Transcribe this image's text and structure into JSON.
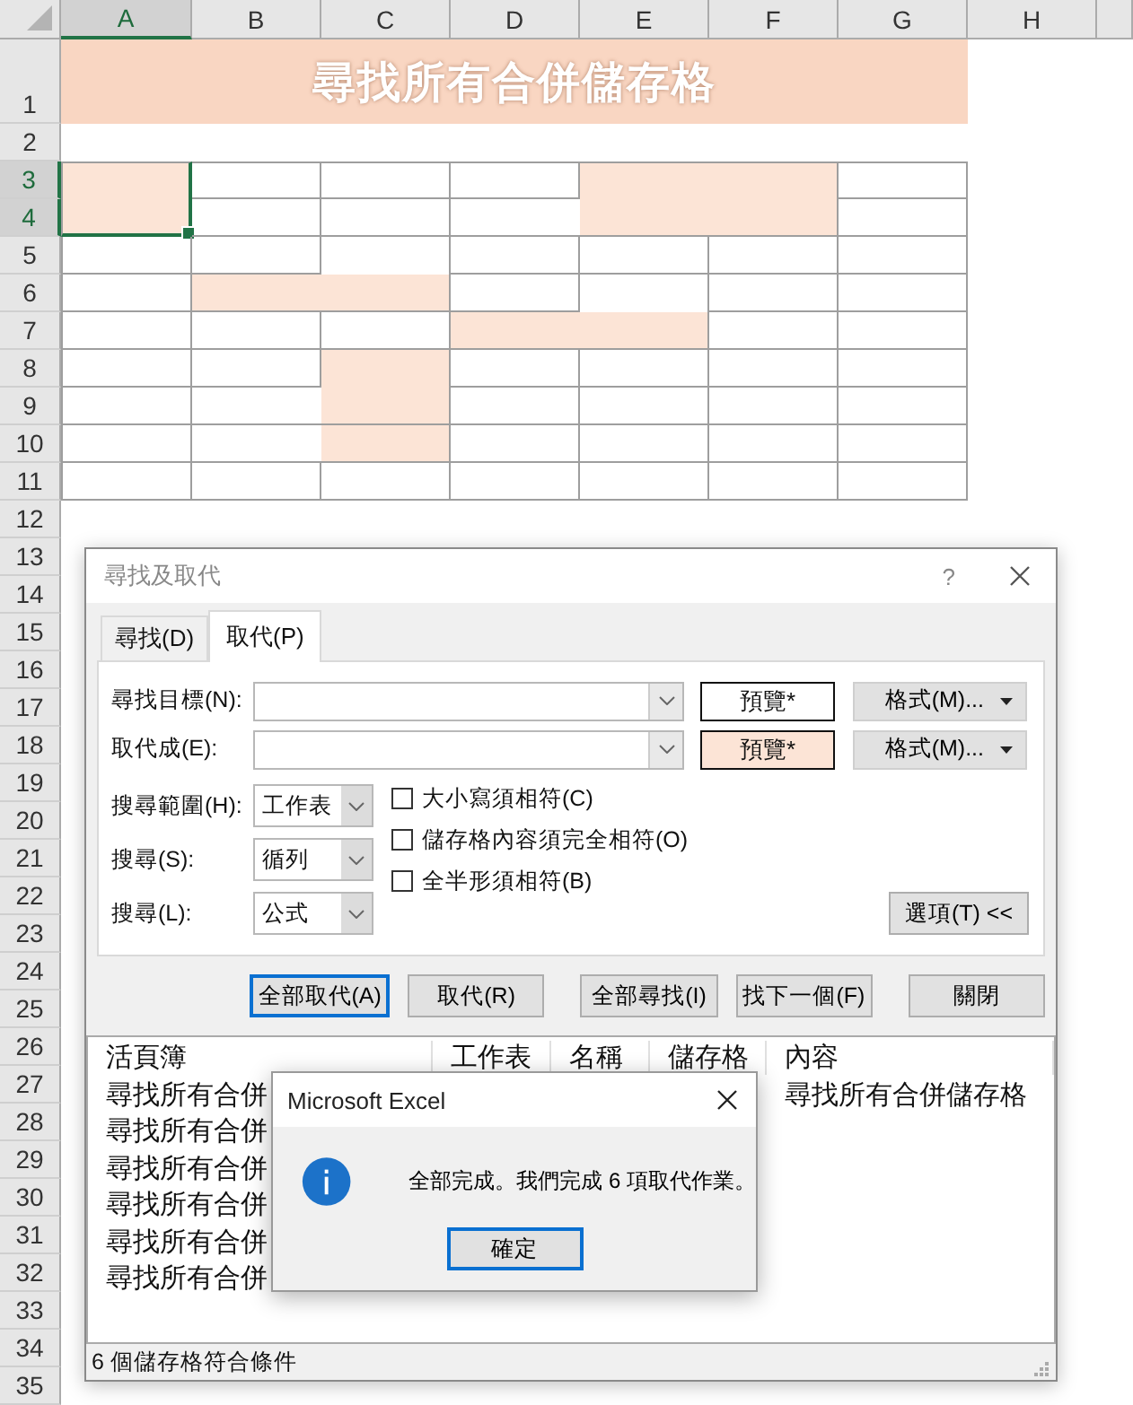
{
  "sheet": {
    "columns": [
      {
        "label": "A",
        "selected": true
      },
      {
        "label": "B",
        "selected": false
      },
      {
        "label": "C",
        "selected": false
      },
      {
        "label": "D",
        "selected": false
      },
      {
        "label": "E",
        "selected": false
      },
      {
        "label": "F",
        "selected": false
      },
      {
        "label": "G",
        "selected": false
      },
      {
        "label": "H",
        "selected": false
      }
    ],
    "rows": [
      {
        "label": "1",
        "selected": false
      },
      {
        "label": "2",
        "selected": false
      },
      {
        "label": "3",
        "selected": true
      },
      {
        "label": "4",
        "selected": true
      },
      {
        "label": "5",
        "selected": false
      },
      {
        "label": "6",
        "selected": false
      },
      {
        "label": "7",
        "selected": false
      },
      {
        "label": "8",
        "selected": false
      },
      {
        "label": "9",
        "selected": false
      },
      {
        "label": "10",
        "selected": false
      },
      {
        "label": "11",
        "selected": false
      },
      {
        "label": "12",
        "selected": false
      },
      {
        "label": "13",
        "selected": false
      },
      {
        "label": "14",
        "selected": false
      },
      {
        "label": "15",
        "selected": false
      },
      {
        "label": "16",
        "selected": false
      },
      {
        "label": "17",
        "selected": false
      },
      {
        "label": "18",
        "selected": false
      },
      {
        "label": "19",
        "selected": false
      },
      {
        "label": "20",
        "selected": false
      },
      {
        "label": "21",
        "selected": false
      },
      {
        "label": "22",
        "selected": false
      },
      {
        "label": "23",
        "selected": false
      },
      {
        "label": "24",
        "selected": false
      },
      {
        "label": "25",
        "selected": false
      },
      {
        "label": "26",
        "selected": false
      },
      {
        "label": "27",
        "selected": false
      },
      {
        "label": "28",
        "selected": false
      },
      {
        "label": "29",
        "selected": false
      },
      {
        "label": "30",
        "selected": false
      },
      {
        "label": "31",
        "selected": false
      },
      {
        "label": "32",
        "selected": false
      },
      {
        "label": "33",
        "selected": false
      },
      {
        "label": "34",
        "selected": false
      },
      {
        "label": "35",
        "selected": false
      }
    ],
    "title": "尋找所有合併儲存格",
    "table": [
      [
        {
          "kind": "shaded",
          "selected": true
        },
        {
          "kind": "plain"
        },
        {
          "kind": "plain"
        },
        {
          "kind": "plain"
        },
        {
          "kind": "shaded",
          "selected": false
        },
        {
          "kind": "merged"
        },
        {
          "kind": "plain"
        }
      ],
      [
        {
          "kind": "merged"
        },
        {
          "kind": "plain"
        },
        {
          "kind": "plain"
        },
        {
          "kind": "plain"
        },
        {
          "kind": "merged"
        },
        {
          "kind": "merged"
        },
        {
          "kind": "plain"
        }
      ],
      [
        {
          "kind": "plain"
        },
        {
          "kind": "plain"
        },
        {
          "kind": "plain"
        },
        {
          "kind": "plain"
        },
        {
          "kind": "plain"
        },
        {
          "kind": "plain"
        },
        {
          "kind": "plain"
        }
      ],
      [
        {
          "kind": "plain"
        },
        {
          "kind": "shaded",
          "selected": false
        },
        {
          "kind": "merged"
        },
        {
          "kind": "plain"
        },
        {
          "kind": "plain"
        },
        {
          "kind": "plain"
        },
        {
          "kind": "plain"
        }
      ],
      [
        {
          "kind": "plain"
        },
        {
          "kind": "plain"
        },
        {
          "kind": "plain"
        },
        {
          "kind": "shaded",
          "selected": false
        },
        {
          "kind": "merged"
        },
        {
          "kind": "plain"
        },
        {
          "kind": "plain"
        }
      ],
      [
        {
          "kind": "plain"
        },
        {
          "kind": "plain"
        },
        {
          "kind": "shaded",
          "selected": false
        },
        {
          "kind": "plain"
        },
        {
          "kind": "plain"
        },
        {
          "kind": "plain"
        },
        {
          "kind": "plain"
        }
      ],
      [
        {
          "kind": "plain"
        },
        {
          "kind": "plain"
        },
        {
          "kind": "merged"
        },
        {
          "kind": "plain"
        },
        {
          "kind": "plain"
        },
        {
          "kind": "plain"
        },
        {
          "kind": "plain"
        }
      ],
      [
        {
          "kind": "plain"
        },
        {
          "kind": "plain"
        },
        {
          "kind": "merged"
        },
        {
          "kind": "plain"
        },
        {
          "kind": "plain"
        },
        {
          "kind": "plain"
        },
        {
          "kind": "plain"
        }
      ],
      [
        {
          "kind": "plain"
        },
        {
          "kind": "plain"
        },
        {
          "kind": "plain"
        },
        {
          "kind": "plain"
        },
        {
          "kind": "plain"
        },
        {
          "kind": "plain"
        },
        {
          "kind": "plain"
        }
      ]
    ]
  },
  "dialog": {
    "title": "尋找及取代",
    "help": "?",
    "tabs": [
      {
        "label": "尋找(D)",
        "selected": false
      },
      {
        "label": "取代(P)",
        "selected": true
      }
    ],
    "fields": [
      {
        "label": "尋找目標(N):",
        "preview": "預覽*",
        "color": "#ffffff",
        "format_button": "格式(M)..."
      },
      {
        "label": "取代成(E):",
        "preview": "預覽*",
        "color": "#fce4d6",
        "format_button": "格式(M)..."
      }
    ],
    "selects": [
      {
        "label": "搜尋範圍(H):",
        "value": "工作表"
      },
      {
        "label": "搜尋(S):",
        "value": "循列"
      },
      {
        "label": "搜尋(L):",
        "value": "公式"
      }
    ],
    "checkboxes": [
      {
        "label": "大小寫須相符(C)",
        "checked": false
      },
      {
        "label": "儲存格內容須完全相符(O)",
        "checked": false
      },
      {
        "label": "全半形須相符(B)",
        "checked": false
      }
    ],
    "options_button": "選項(T) <<",
    "buttons": [
      {
        "label": "全部取代(A)",
        "focused": true
      },
      {
        "label": "取代(R)",
        "focused": false
      },
      {
        "label": "全部尋找(I)",
        "focused": false
      },
      {
        "label": "找下一個(F)",
        "focused": false
      },
      {
        "label": "關閉",
        "focused": false
      }
    ],
    "results": {
      "columns": [
        "活頁簿",
        "工作表",
        "名稱",
        "儲存格",
        "內容"
      ],
      "rows": [
        {
          "workbook": "尋找所有合併",
          "content": "尋找所有合併儲存格"
        },
        {
          "workbook": "尋找所有合併"
        },
        {
          "workbook": "尋找所有合併"
        },
        {
          "workbook": "尋找所有合併"
        },
        {
          "workbook": "尋找所有合併"
        },
        {
          "workbook": "尋找所有合併"
        }
      ]
    },
    "status": "6 個儲存格符合條件"
  },
  "message_box": {
    "title": "Microsoft Excel",
    "message": "全部完成。我們完成 6 項取代作業。",
    "button": "確定"
  }
}
